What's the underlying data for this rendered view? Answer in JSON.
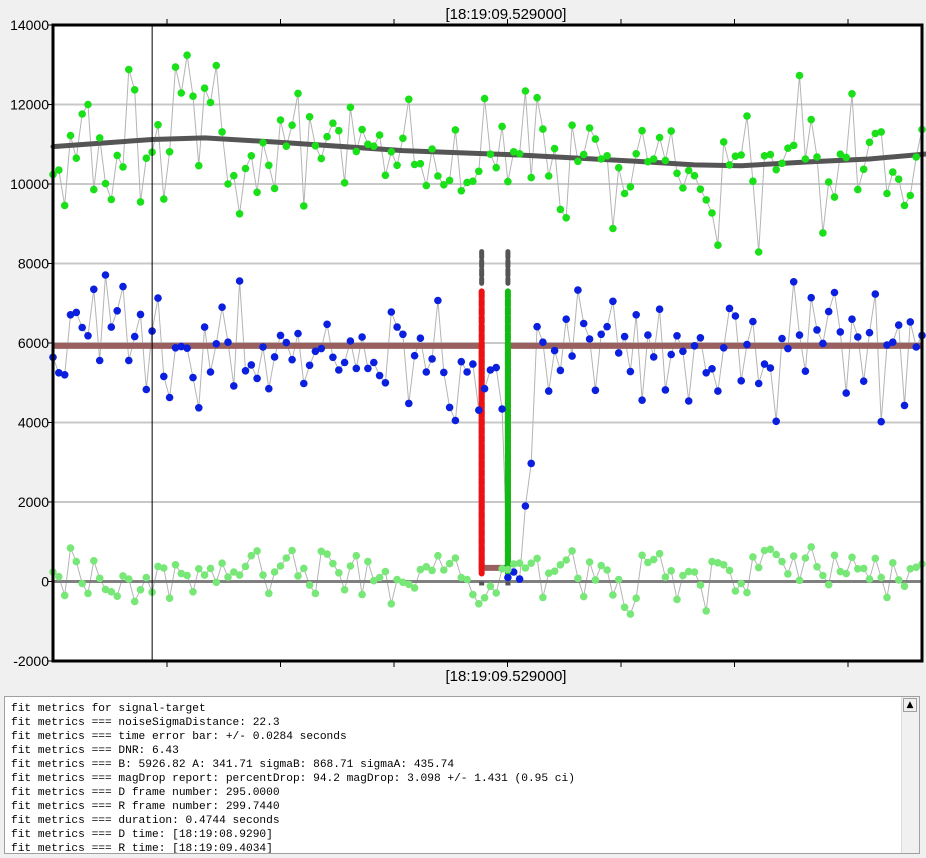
{
  "chart_data": {
    "type": "scatter",
    "title": "[18:19:09.529000]",
    "xlabel": "[18:19:09.529000]",
    "ylim": [
      -2000,
      14000
    ],
    "yticks": [
      -2000,
      0,
      2000,
      4000,
      6000,
      8000,
      10000,
      12000,
      14000
    ],
    "ytick_labels": [
      "-2000",
      "0",
      "2000",
      "4000",
      "6000",
      "8000",
      "10000",
      "12000",
      "14000"
    ],
    "grid": true,
    "n_points": 150,
    "cursor_index": 17,
    "D_index": 73.5,
    "R_index": 78.0,
    "colors": {
      "target": "#0b1fde",
      "comparison": "#19e019",
      "noise": "#77e877",
      "baseline_fit": "#9a6060",
      "zero_line": "#808080",
      "trend_line": "#555555",
      "D_edge": "#ee1111",
      "R_edge": "#11bb11",
      "edge_marker": "#555555",
      "connecting_line": "#b4b4b4",
      "cursor": "#000000"
    },
    "baseline_level": 5926.82,
    "event_level": 341.71,
    "trend_line": [
      {
        "x": 0,
        "y": 10940
      },
      {
        "x": 17,
        "y": 11120
      },
      {
        "x": 26,
        "y": 11160
      },
      {
        "x": 40,
        "y": 11040
      },
      {
        "x": 60,
        "y": 10840
      },
      {
        "x": 80,
        "y": 10730
      },
      {
        "x": 100,
        "y": 10570
      },
      {
        "x": 110,
        "y": 10480
      },
      {
        "x": 118,
        "y": 10460
      },
      {
        "x": 130,
        "y": 10560
      },
      {
        "x": 140,
        "y": 10630
      },
      {
        "x": 150,
        "y": 10760
      }
    ],
    "series": [
      {
        "name": "target",
        "values": [
          5640,
          5250,
          5200,
          6710,
          6770,
          6390,
          6180,
          7350,
          5560,
          7710,
          6400,
          6810,
          7420,
          5560,
          6160,
          6720,
          4830,
          6300,
          7130,
          5160,
          4630,
          5880,
          5910,
          5870,
          5130,
          4370,
          6400,
          5270,
          5980,
          6900,
          6020,
          4920,
          7560,
          5300,
          5450,
          5110,
          5900,
          4850,
          5650,
          6190,
          6010,
          5580,
          6240,
          4980,
          5440,
          5790,
          5860,
          6470,
          5640,
          5320,
          5510,
          6050,
          5360,
          6150,
          5360,
          5510,
          5180,
          5000,
          6780,
          6400,
          6220,
          4480,
          5680,
          6120,
          5270,
          5600,
          7070,
          5260,
          4380,
          4050,
          5530,
          5270,
          5470,
          4310,
          4850,
          5320,
          5380,
          4340,
          100,
          240,
          60,
          1900,
          2970,
          6410,
          6020,
          4790,
          5810,
          5310,
          6600,
          5670,
          7330,
          6490,
          6100,
          4810,
          6220,
          6410,
          7050,
          5750,
          6160,
          5280,
          6710,
          4560,
          6200,
          5650,
          6850,
          4820,
          5710,
          6180,
          5790,
          4540,
          5930,
          6130,
          5250,
          5350,
          4790,
          5880,
          6870,
          6680,
          5050,
          5960,
          6540,
          4980,
          5470,
          5370,
          4030,
          6110,
          5860,
          7540,
          6200,
          5290,
          7140,
          6330,
          5990,
          6790,
          7270,
          6280,
          4740,
          6600,
          6150,
          5040,
          6260,
          7230,
          4020,
          5950,
          6020,
          6450,
          4430,
          6530,
          5900,
          6190
        ]
      },
      {
        "name": "comparison",
        "values": [
          10240,
          10350,
          9460,
          11220,
          10650,
          11760,
          12000,
          9860,
          11160,
          10010,
          9610,
          10720,
          10430,
          12880,
          12370,
          9550,
          10650,
          10800,
          11490,
          9620,
          10810,
          12940,
          12290,
          13240,
          12210,
          10460,
          12410,
          12050,
          12980,
          11310,
          10000,
          10210,
          9250,
          10390,
          10710,
          9790,
          11040,
          10470,
          9890,
          11610,
          10950,
          11480,
          12280,
          9450,
          11690,
          10960,
          10640,
          11190,
          11530,
          11340,
          10030,
          11930,
          10820,
          11370,
          11000,
          10950,
          11230,
          10220,
          10810,
          10470,
          11150,
          12130,
          10490,
          10510,
          9960,
          10880,
          10200,
          9980,
          10090,
          11360,
          9830,
          10040,
          10070,
          10320,
          12150,
          10750,
          10410,
          11450,
          10060,
          10810,
          10760,
          12340,
          10160,
          12170,
          11380,
          10200,
          10890,
          9360,
          9150,
          11480,
          10570,
          10740,
          11410,
          11130,
          10630,
          10710,
          8880,
          10410,
          9760,
          9930,
          10760,
          11340,
          10560,
          10630,
          11170,
          10590,
          11330,
          10270,
          9900,
          10340,
          10210,
          9870,
          9600,
          9270,
          8460,
          11060,
          10480,
          10700,
          10730,
          11710,
          10070,
          8290,
          10710,
          10740,
          10360,
          10520,
          10900,
          10970,
          12730,
          10630,
          11620,
          10680,
          8770,
          10050,
          9670,
          10750,
          10670,
          12270,
          9860,
          10370,
          11050,
          11270,
          11310,
          9760,
          10300,
          10120,
          9460,
          9710,
          10680,
          11370
        ]
      },
      {
        "name": "noise",
        "values": [
          240,
          120,
          -350,
          840,
          500,
          -50,
          -300,
          520,
          80,
          -200,
          -260,
          -370,
          140,
          60,
          -500,
          -210,
          100,
          -270,
          380,
          340,
          -420,
          420,
          200,
          150,
          -260,
          320,
          160,
          330,
          -20,
          460,
          110,
          240,
          160,
          380,
          650,
          770,
          160,
          -300,
          240,
          390,
          590,
          780,
          140,
          330,
          -90,
          -300,
          760,
          690,
          450,
          220,
          -210,
          390,
          650,
          -330,
          500,
          20,
          100,
          250,
          -560,
          50,
          -20,
          -70,
          -160,
          300,
          370,
          280,
          650,
          290,
          450,
          590,
          100,
          50,
          -330,
          -560,
          -410,
          -120,
          -290,
          320,
          300,
          440,
          460,
          340,
          460,
          580,
          -400,
          210,
          260,
          420,
          540,
          770,
          80,
          -380,
          490,
          40,
          400,
          290,
          -340,
          50,
          -650,
          -820,
          -420,
          660,
          480,
          550,
          700,
          110,
          270,
          -450,
          150,
          250,
          240,
          -90,
          -740,
          500,
          470,
          420,
          280,
          -240,
          -50,
          -280,
          620,
          350,
          780,
          810,
          680,
          500,
          190,
          640,
          30,
          590,
          870,
          370,
          150,
          -80,
          660,
          250,
          200,
          610,
          320,
          330,
          60,
          580,
          100,
          -400,
          470,
          40,
          -120,
          320,
          360,
          440
        ]
      }
    ]
  },
  "log": {
    "lines": [
      "fit metrics for signal-target",
      "fit metrics === noiseSigmaDistance: 22.3",
      "fit metrics === time error bar: +/- 0.0284 seconds",
      "fit metrics === DNR: 6.43",
      "fit metrics === B: 5926.82 A: 341.71 sigmaB: 868.71 sigmaA: 435.74",
      "fit metrics === magDrop report: percentDrop: 94.2 magDrop: 3.098 +/- 1.431 (0.95 ci)",
      "fit metrics === D frame number: 295.0000",
      "fit metrics === R frame number: 299.7440",
      "fit metrics === duration: 0.4744 seconds",
      "fit metrics === D time: [18:19:08.9290]",
      "fit metrics === R time: [18:19:09.4034]"
    ],
    "scroll_up_glyph": "▲"
  }
}
